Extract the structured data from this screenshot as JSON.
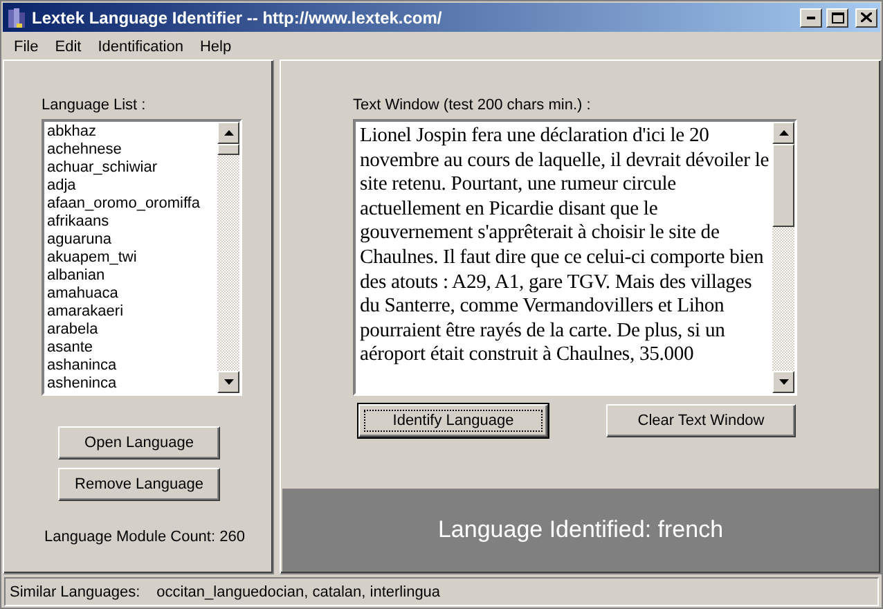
{
  "window": {
    "title": "Lextek Language Identifier -- http://www.lextek.com/"
  },
  "menu": [
    {
      "label": "File"
    },
    {
      "label": "Edit"
    },
    {
      "label": "Identification"
    },
    {
      "label": "Help"
    }
  ],
  "language_list": {
    "label": "Language List :",
    "items": [
      "abkhaz",
      "achehnese",
      "achuar_schiwiar",
      "adja",
      "afaan_oromo_oromiffa",
      "afrikaans",
      "aguaruna",
      "akuapem_twi",
      "albanian",
      "amahuaca",
      "amarakaeri",
      "arabela",
      "asante",
      "ashaninca",
      "asheninca"
    ]
  },
  "left_buttons": [
    "Open Language",
    "Remove Language"
  ],
  "module_count": "Language Module Count: 260",
  "text_window": {
    "label": "Text Window  (test 200 chars min.) :",
    "value": "Lionel Jospin fera une déclaration d'ici le 20 novembre au cours de laquelle, il devrait dévoiler le site retenu. Pourtant, une rumeur circule actuellement en Picardie disant que le gouvernement s'apprêterait à choisir le site de Chaulnes. Il faut dire que ce celui-ci comporte bien des atouts : A29, A1, gare TGV. Mais des villages du Santerre, comme Vermandovillers et Lihon pourraient être rayés de la carte. De plus, si un aéroport était construit à Chaulnes, 35.000"
  },
  "right_buttons": [
    {
      "label": "Identify Language",
      "focused": true
    },
    {
      "label": "Clear Text Window",
      "focused": false
    }
  ],
  "result": "Language Identified: french",
  "status_bar": {
    "label": "Similar Languages:",
    "value": "occitan_languedocian, catalan, interlingua"
  }
}
